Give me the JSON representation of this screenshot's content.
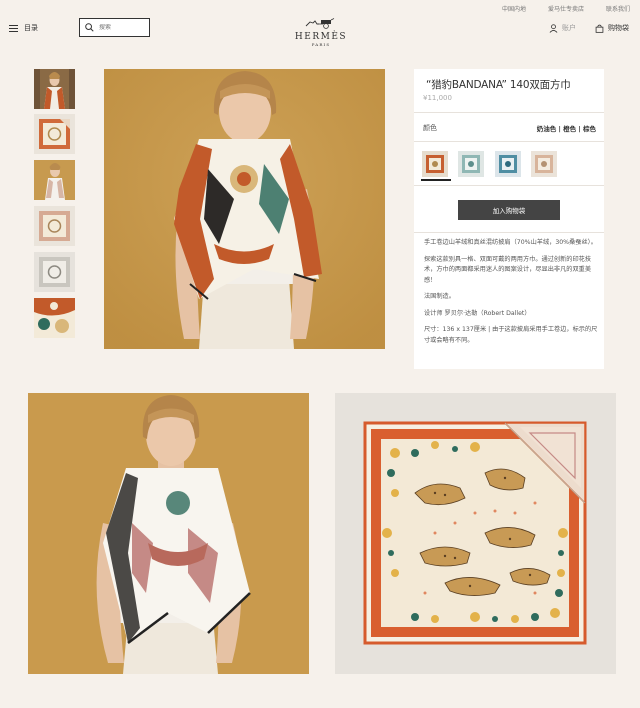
{
  "utility_links": [
    "中国内地",
    "爱马仕专卖店",
    "联系我们"
  ],
  "header": {
    "menu_label": "目录",
    "search_placeholder": "搜索",
    "brand": "HERMÈS",
    "brand_sub": "PARIS",
    "account_label": "账户",
    "cart_label": "购物袋"
  },
  "product": {
    "title": "“猎豹BANDANA” 140双面方巾",
    "price": "¥11,000",
    "color_label": "颜色",
    "colors": "奶油色 | 橙色 | 棕色",
    "add_to_bag": "加入购物袋",
    "description": [
      "手工卷边山羊绒和真丝混纺披肩（70%山羊绒，30%桑蚕丝）。",
      "探索这款别具一格、双面可戴的两用方巾。通过创新的印花技术，方巾的两面都采用迷人的图案设计，尽显出非凡的双重美感！",
      "法国制造。",
      "设计师 罗贝尔·达勒（Robert Dallet）",
      "尺寸：136 x 137厘米 | 由于这款披肩采用手工卷边，标示的尺寸或会略有不同。"
    ]
  },
  "colors": {
    "background": "#f6f1eb",
    "mustard": "#c79a4f",
    "scarf_orange": "#c25a2a",
    "button": "#444444"
  },
  "icons": [
    "hamburger-icon",
    "search-icon",
    "hermes-carriage-logo",
    "user-icon",
    "bag-icon"
  ]
}
